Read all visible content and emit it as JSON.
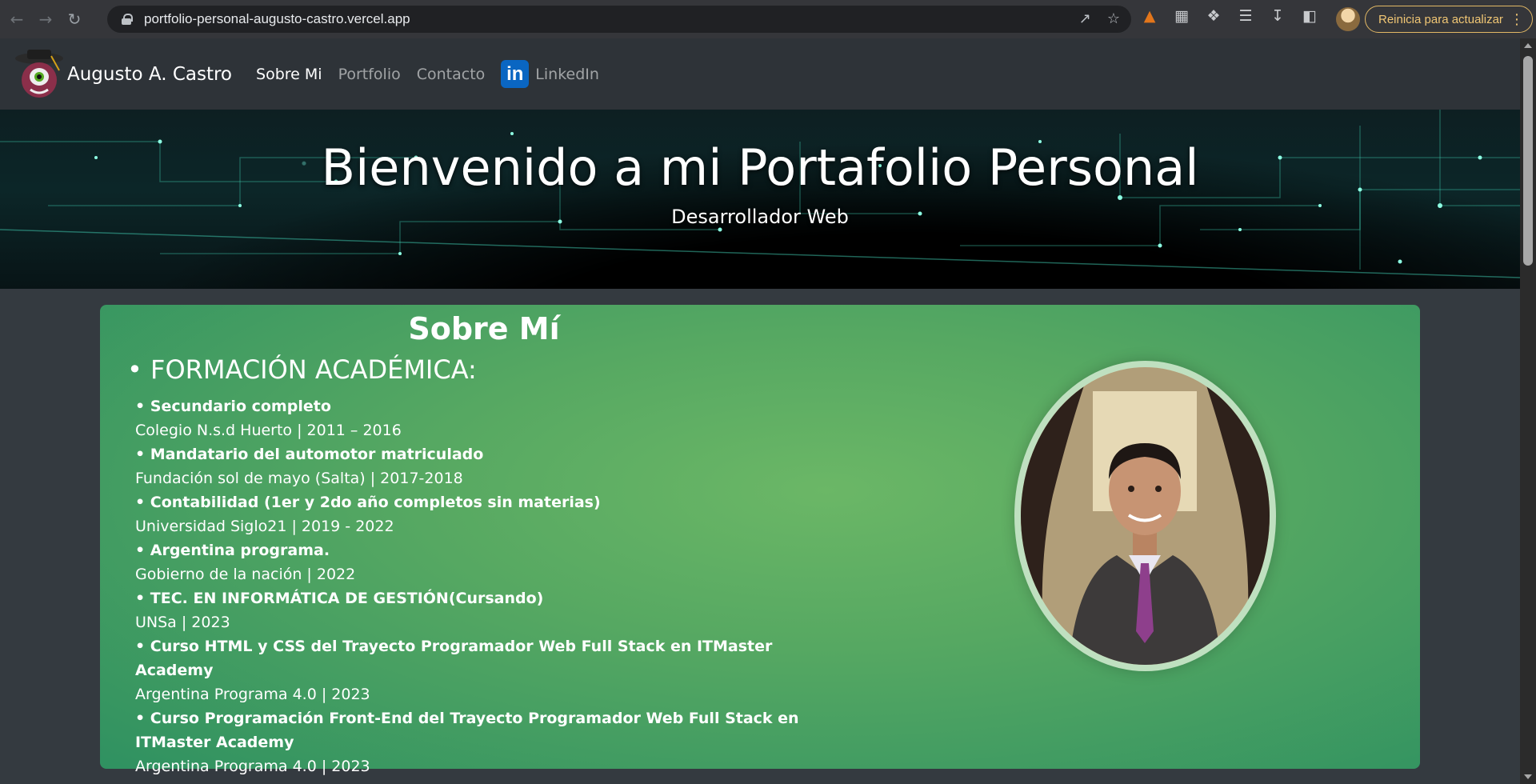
{
  "browser": {
    "url": "portfolio-personal-augusto-castro.vercel.app",
    "update_label": "Reinicia para actualizar"
  },
  "nav": {
    "brand": "Augusto A. Castro",
    "links": [
      "Sobre Mi",
      "Portfolio",
      "Contacto"
    ],
    "linkedin_label": "LinkedIn",
    "active_link": "Sobre Mi"
  },
  "hero": {
    "title": "Bienvenido a mi Portafolio Personal",
    "subtitle": "Desarrollador Web"
  },
  "about": {
    "title": "Sobre Mí",
    "section_heading": "• FORMACIÓN ACADÉMICA:",
    "items": [
      {
        "title": "• Secundario completo",
        "detail": "Colegio N.s.d Huerto | 2011 – 2016"
      },
      {
        "title": "• Mandatario del automotor matriculado",
        "detail": "Fundación sol de mayo (Salta) | 2017-2018"
      },
      {
        "title": "• Contabilidad (1er y 2do año completos sin materias)",
        "detail": "Universidad Siglo21 | 2019 - 2022"
      },
      {
        "title": "• Argentina programa.",
        "detail": "Gobierno de la nación | 2022"
      },
      {
        "title": "• TEC. EN INFORMÁTICA DE GESTIÓN(Cursando)",
        "detail": "UNSa | 2023"
      },
      {
        "title": "• Curso HTML y CSS del Trayecto Programador Web Full Stack en ITMaster Academy",
        "detail": "Argentina Programa 4.0 | 2023"
      },
      {
        "title": "• Curso Programación Front-End del Trayecto Programador Web Full Stack en ITMaster Academy",
        "detail": "Argentina Programa 4.0 | 2023"
      }
    ]
  },
  "colors": {
    "card_green": "#56a862",
    "linkedin_blue": "#0a66c2",
    "navbar": "#2e3338"
  }
}
